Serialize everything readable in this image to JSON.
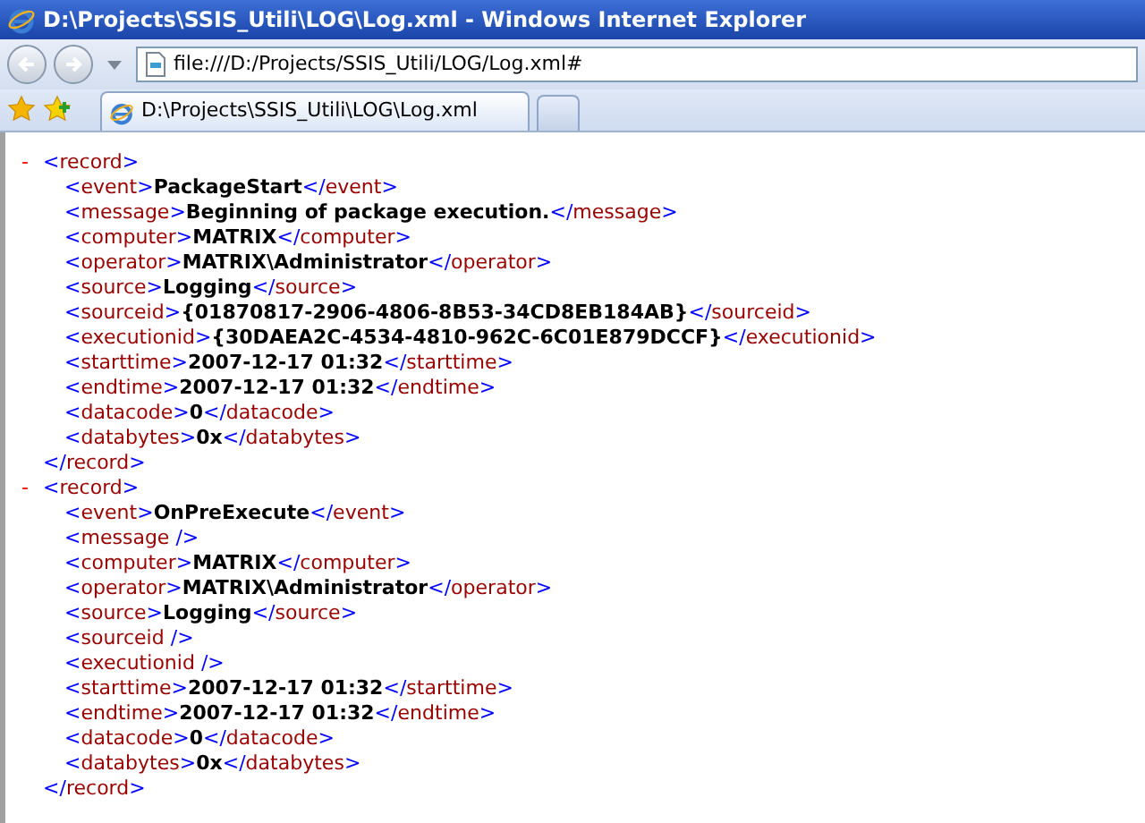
{
  "window": {
    "title": "D:\\Projects\\SSIS_Utili\\LOG\\Log.xml - Windows Internet Explorer"
  },
  "address_bar": {
    "value": "file:///D:/Projects/SSIS_Utili/LOG/Log.xml#"
  },
  "tabs": [
    {
      "label": "D:\\Projects\\SSIS_Utili\\LOG\\Log.xml",
      "selected": true
    }
  ],
  "records": [
    {
      "toggle": "-",
      "open": "<record>",
      "close": "</record>",
      "children": [
        {
          "open": "<event>",
          "value": "PackageStart",
          "close": "</event>"
        },
        {
          "open": "<message>",
          "value": "Beginning of package execution.",
          "close": "</message>"
        },
        {
          "open": "<computer>",
          "value": "MATRIX",
          "close": "</computer>"
        },
        {
          "open": "<operator>",
          "value": "MATRIX\\Administrator",
          "close": "</operator>"
        },
        {
          "open": "<source>",
          "value": "Logging",
          "close": "</source>"
        },
        {
          "open": "<sourceid>",
          "value": "{01870817-2906-4806-8B53-34CD8EB184AB}",
          "close": "</sourceid>"
        },
        {
          "open": "<executionid>",
          "value": "{30DAEA2C-4534-4810-962C-6C01E879DCCF}",
          "close": "</executionid>"
        },
        {
          "open": "<starttime>",
          "value": "2007-12-17 01:32",
          "close": "</starttime>"
        },
        {
          "open": "<endtime>",
          "value": "2007-12-17 01:32",
          "close": "</endtime>"
        },
        {
          "open": "<datacode>",
          "value": "0",
          "close": "</datacode>"
        },
        {
          "open": "<databytes>",
          "value": "0x",
          "close": "</databytes>"
        }
      ]
    },
    {
      "toggle": "-",
      "open": "<record>",
      "close": "</record>",
      "children": [
        {
          "open": "<event>",
          "value": "OnPreExecute",
          "close": "</event>"
        },
        {
          "open": "<message />"
        },
        {
          "open": "<computer>",
          "value": "MATRIX",
          "close": "</computer>"
        },
        {
          "open": "<operator>",
          "value": "MATRIX\\Administrator",
          "close": "</operator>"
        },
        {
          "open": "<source>",
          "value": "Logging",
          "close": "</source>"
        },
        {
          "open": "<sourceid />"
        },
        {
          "open": "<executionid />"
        },
        {
          "open": "<starttime>",
          "value": "2007-12-17 01:32",
          "close": "</starttime>"
        },
        {
          "open": "<endtime>",
          "value": "2007-12-17 01:32",
          "close": "</endtime>"
        },
        {
          "open": "<datacode>",
          "value": "0",
          "close": "</datacode>"
        },
        {
          "open": "<databytes>",
          "value": "0x",
          "close": "</databytes>"
        }
      ]
    }
  ]
}
